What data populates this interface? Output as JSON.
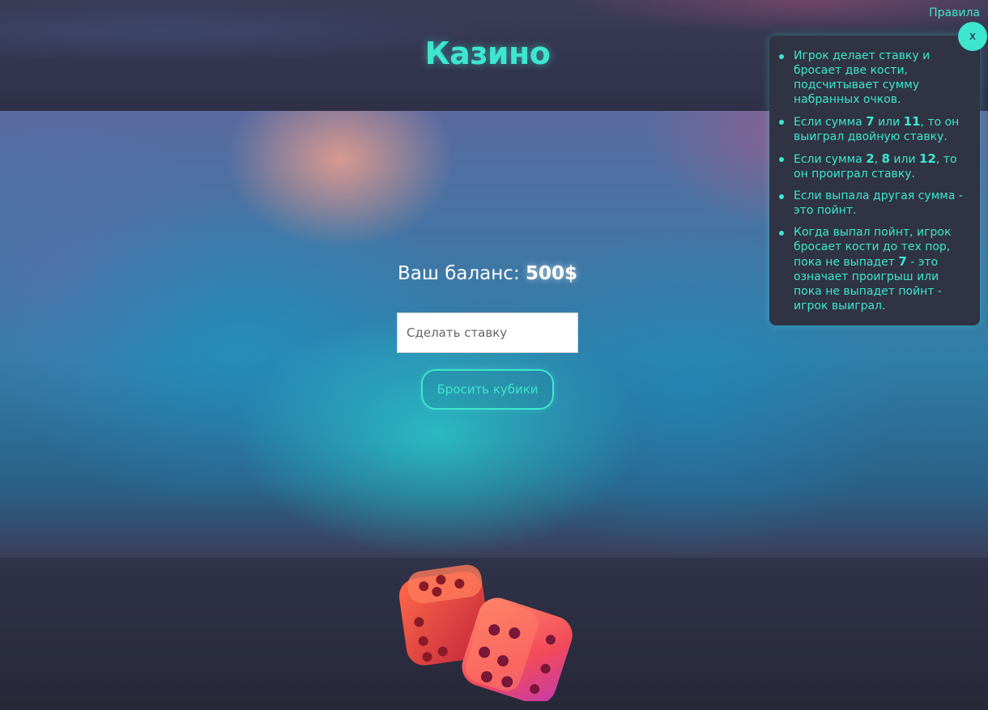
{
  "header": {
    "title": "Казино"
  },
  "rules": {
    "link_label": "Правила",
    "close_label": "x",
    "items": [
      {
        "parts": [
          {
            "text": "Игрок делает ставку и бросает две кости, подсчитывает сумму набранных очков."
          }
        ]
      },
      {
        "parts": [
          {
            "text": "Если сумма "
          },
          {
            "text": "7",
            "bold": true
          },
          {
            "text": " или "
          },
          {
            "text": "11",
            "bold": true
          },
          {
            "text": ", то он выиграл двойную ставку."
          }
        ]
      },
      {
        "parts": [
          {
            "text": "Если сумма "
          },
          {
            "text": "2",
            "bold": true
          },
          {
            "text": ", "
          },
          {
            "text": "8",
            "bold": true
          },
          {
            "text": " или "
          },
          {
            "text": "12",
            "bold": true
          },
          {
            "text": ", то он проиграл ставку."
          }
        ]
      },
      {
        "parts": [
          {
            "text": "Если выпала другая сумма - это пойнт."
          }
        ]
      },
      {
        "parts": [
          {
            "text": "Когда выпал пойнт, игрок бросает кости до тех пор, пока не выпадет "
          },
          {
            "text": "7",
            "bold": true
          },
          {
            "text": " - это означает проигрыш или пока не выпадет пойнт - игрок выиграл."
          }
        ]
      }
    ]
  },
  "game": {
    "balance_label": "Ваш баланс: ",
    "balance_value": "500$",
    "bet_placeholder": "Сделать ставку",
    "bet_value": "",
    "roll_button_label": "Бросить кубики"
  },
  "colors": {
    "accent": "#3ee6cf",
    "panel_bg": "#2f3344",
    "page_bg": "#2a2b3d",
    "dice": "#f0504a"
  },
  "icons": {
    "dice": "dice-pair-icon"
  }
}
